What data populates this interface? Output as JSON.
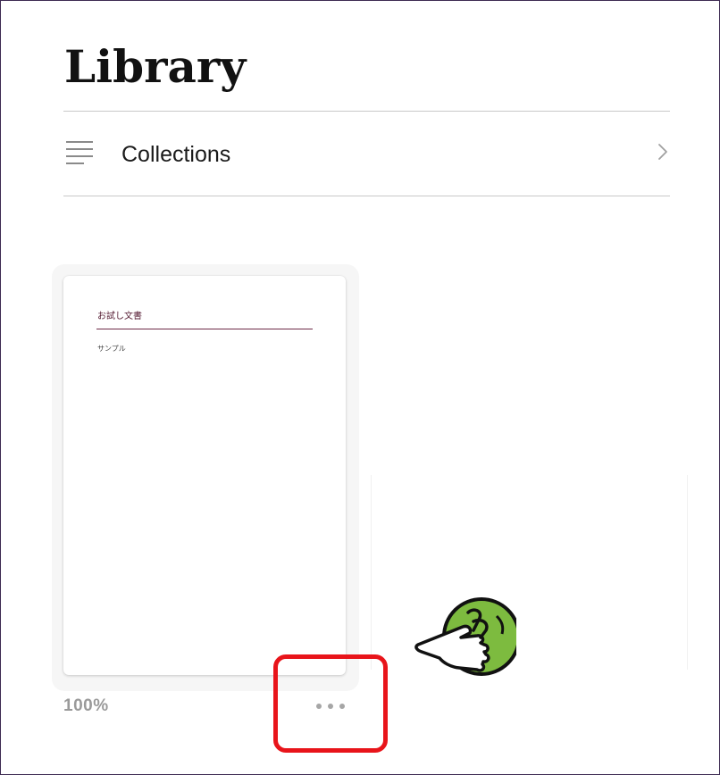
{
  "page": {
    "title": "Library"
  },
  "collections": {
    "label": "Collections",
    "icon": "list-icon",
    "chevron_icon": "chevron-right-icon"
  },
  "books": [
    {
      "cover_title": "お試し文書",
      "cover_subtitle": "サンプル",
      "progress": "100%",
      "more_icon": "more-options-icon"
    }
  ],
  "annotations": {
    "highlight_color": "#e8141a",
    "pointer_icon": "pointing-hand-icon",
    "pointer_color": "#7dbb3f"
  }
}
